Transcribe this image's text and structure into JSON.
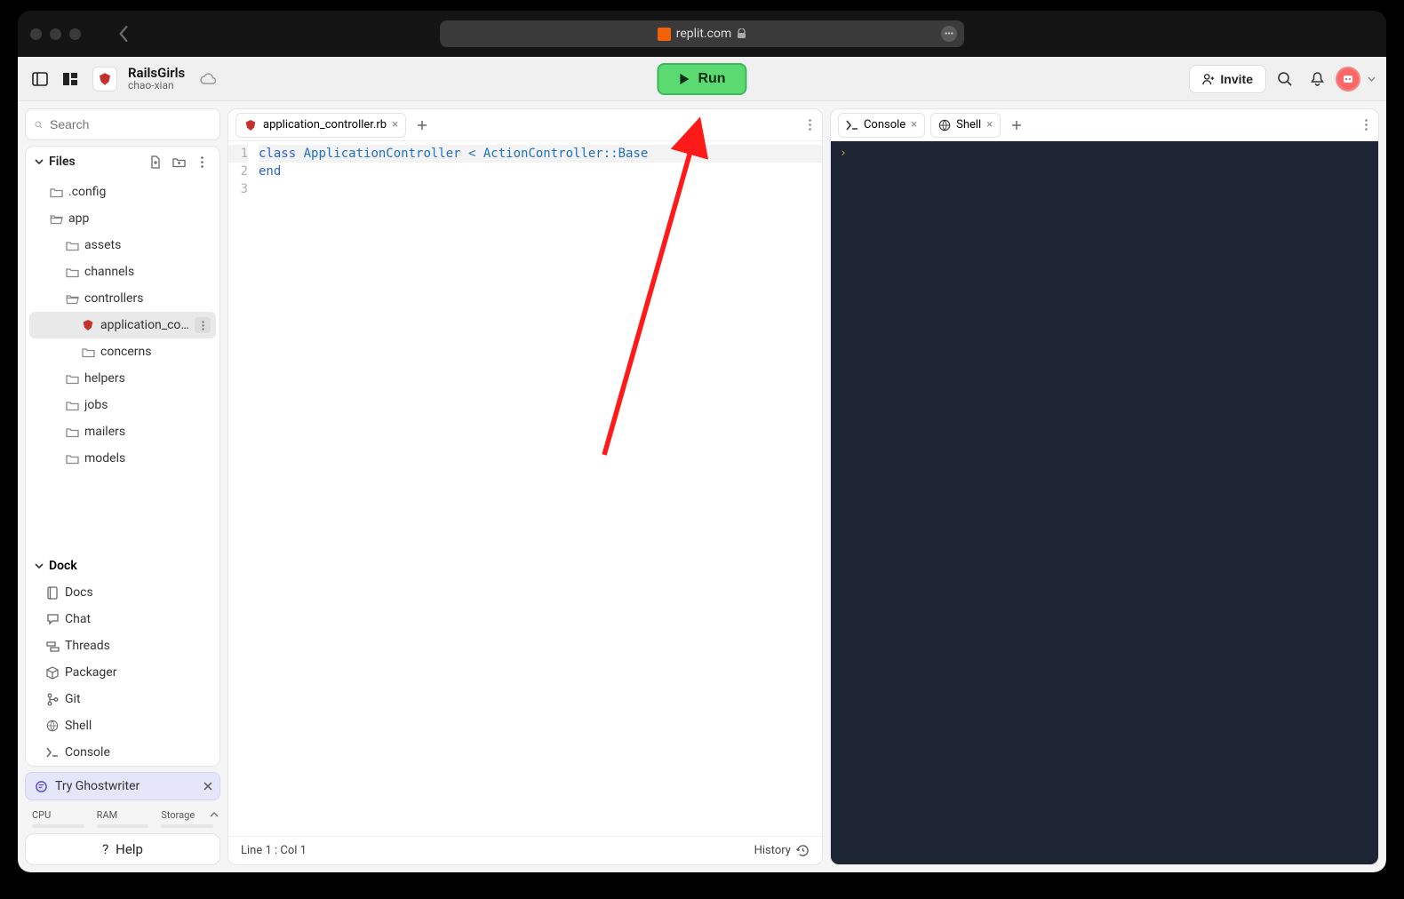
{
  "browser": {
    "url": "replit.com"
  },
  "header": {
    "project": "RailsGirls",
    "owner": "chao-xian",
    "run_label": "Run",
    "invite_label": "Invite"
  },
  "sidebar": {
    "search_placeholder": "Search",
    "files_label": "Files",
    "tree": [
      {
        "name": ".config",
        "type": "folder",
        "indent": 1
      },
      {
        "name": "app",
        "type": "folder-open",
        "indent": 1
      },
      {
        "name": "assets",
        "type": "folder",
        "indent": 2
      },
      {
        "name": "channels",
        "type": "folder",
        "indent": 2
      },
      {
        "name": "controllers",
        "type": "folder-open",
        "indent": 2
      },
      {
        "name": "application_co…",
        "type": "ruby",
        "indent": 3,
        "active": true
      },
      {
        "name": "concerns",
        "type": "folder",
        "indent": 3
      },
      {
        "name": "helpers",
        "type": "folder",
        "indent": 2
      },
      {
        "name": "jobs",
        "type": "folder",
        "indent": 2
      },
      {
        "name": "mailers",
        "type": "folder",
        "indent": 2
      },
      {
        "name": "models",
        "type": "folder",
        "indent": 2
      }
    ],
    "dock_label": "Dock",
    "dock": [
      {
        "name": "Docs",
        "icon": "book"
      },
      {
        "name": "Chat",
        "icon": "chat"
      },
      {
        "name": "Threads",
        "icon": "threads"
      },
      {
        "name": "Packager",
        "icon": "package"
      },
      {
        "name": "Git",
        "icon": "git"
      },
      {
        "name": "Shell",
        "icon": "shell"
      },
      {
        "name": "Console",
        "icon": "console"
      }
    ],
    "ghostwriter_label": "Try Ghostwriter",
    "resources": {
      "cpu": "CPU",
      "ram": "RAM",
      "storage": "Storage"
    },
    "help_label": "Help"
  },
  "editor": {
    "tab_label": "application_controller.rb",
    "line_numbers": [
      "1",
      "2",
      "3"
    ],
    "code_lines": [
      {
        "pre": "class",
        "mid": " ApplicationController < ActionController::Base"
      },
      {
        "pre": "end",
        "mid": ""
      },
      {
        "pre": "",
        "mid": ""
      }
    ],
    "status_pos": "Line 1 : Col 1",
    "history_label": "History"
  },
  "console": {
    "tab1": "Console",
    "tab2": "Shell",
    "prompt": "›"
  }
}
